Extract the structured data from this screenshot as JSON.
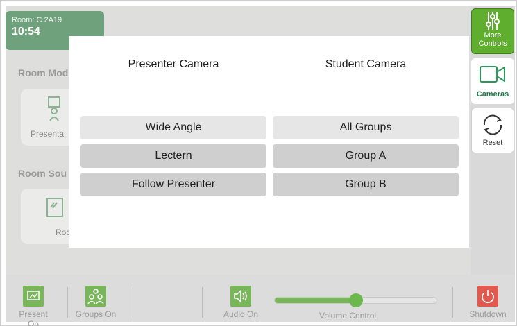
{
  "room": {
    "label": "Room: C.2A19",
    "time": "10:54"
  },
  "sections": {
    "room_mode": "Room Mod",
    "room_source": "Room Sou"
  },
  "tiles": {
    "mode_tile_label": "Presenta",
    "source_tile_label": "Roc"
  },
  "right_panel": {
    "more_controls_line1": "More",
    "more_controls_line2": "Controls",
    "cameras_label": "Cameras",
    "reset_label": "Reset"
  },
  "modal": {
    "presenter_title": "Presenter Camera",
    "student_title": "Student Camera",
    "presenter_options": [
      "Wide Angle",
      "Lectern",
      "Follow Presenter"
    ],
    "student_options": [
      "All Groups",
      "Group A",
      "Group B"
    ],
    "presenter_selected": "Wide Angle",
    "student_selected": "All Groups"
  },
  "bottom_bar": {
    "present_label": "Present On",
    "groups_label": "Groups On",
    "audio_label": "Audio On",
    "volume_label": "Volume Control",
    "volume_level": 0.5,
    "shutdown_label": "Shutdown"
  },
  "colors": {
    "accent_green": "#5fae2e",
    "room_card_green": "#6fa17c",
    "camera_text_green": "#1e7a4a",
    "shutdown_red": "#e05a4f",
    "volume_green": "#79b65a"
  },
  "icons": [
    "sliders-icon",
    "video-camera-icon",
    "refresh-icon",
    "presentation-icon",
    "groups-icon",
    "speaker-icon",
    "power-icon",
    "monitor-icon"
  ]
}
